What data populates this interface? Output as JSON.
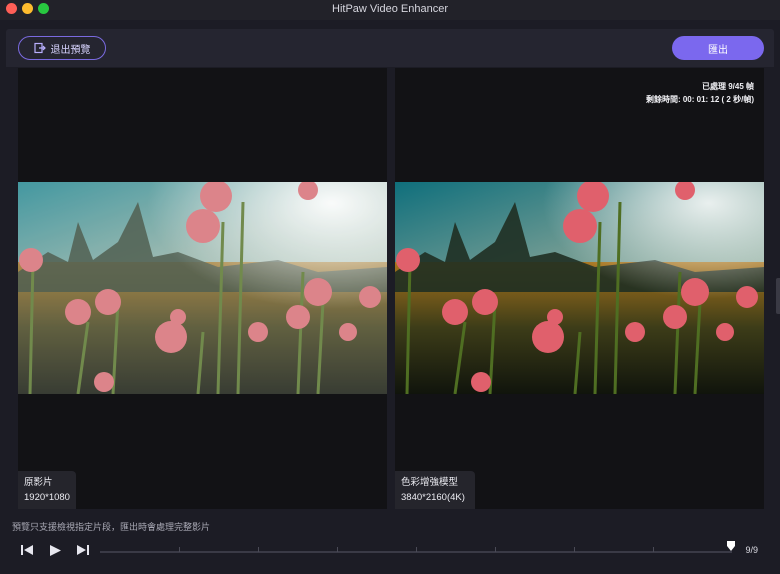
{
  "window": {
    "title": "HitPaw Video Enhancer"
  },
  "toolbar": {
    "exit_label": "退出預覽",
    "export_label": "匯出"
  },
  "original": {
    "label": "原影片",
    "resolution": "1920*1080"
  },
  "enhanced": {
    "label": "色彩增強模型",
    "resolution": "3840*2160(4K)",
    "processed": "已處理 9/45 幀",
    "remaining": "剩餘時間: 00: 01: 12 ( 2 秒/幀)"
  },
  "notice": "預覽只支援檢視指定片段，匯出時會處理完整影片",
  "player": {
    "frame_counter": "9/9",
    "progress": 1.0
  },
  "colors": {
    "accent": "#7b68ee",
    "background": "#1c1c25"
  },
  "icons": {
    "exit": "exit-icon",
    "prev": "previous-frame-icon",
    "play": "play-icon",
    "next": "next-frame-icon",
    "playhead": "playhead-marker-icon"
  }
}
